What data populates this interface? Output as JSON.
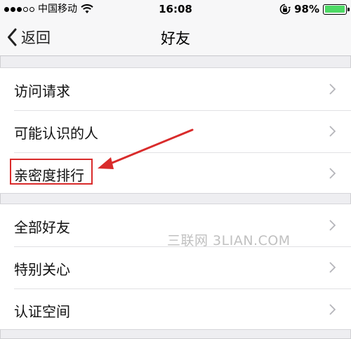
{
  "status_bar": {
    "carrier": "中国移动",
    "time": "16:08",
    "battery_percent": "98%",
    "battery_level": 0.98,
    "battery_color": "#4cd964"
  },
  "nav": {
    "back_label": "返回",
    "title": "好友"
  },
  "groups": [
    {
      "items": [
        {
          "label": "访问请求"
        },
        {
          "label": "可能认识的人"
        },
        {
          "label": "亲密度排行",
          "highlighted": true
        }
      ]
    },
    {
      "items": [
        {
          "label": "全部好友"
        },
        {
          "label": "特别关心"
        },
        {
          "label": "认证空间"
        }
      ]
    }
  ],
  "annotation": {
    "color": "#d92b2b"
  },
  "watermark": "三联网 3LIAN.COM"
}
